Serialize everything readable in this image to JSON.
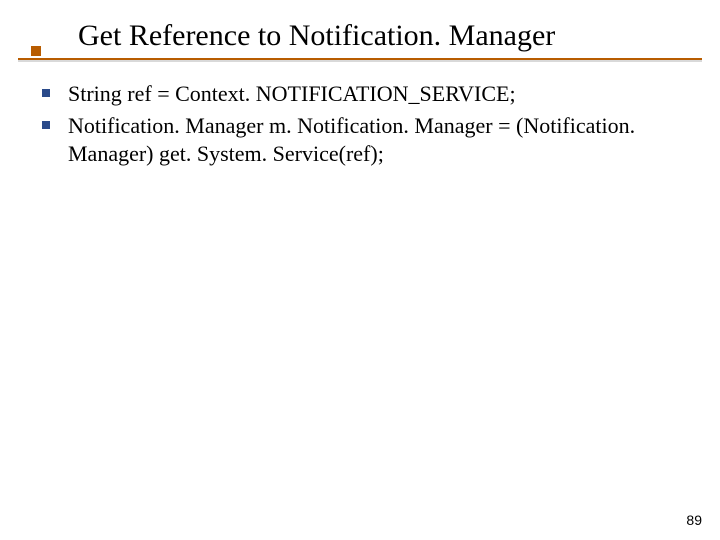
{
  "title": "Get Reference to Notification. Manager",
  "bullets": [
    "String ref = Context. NOTIFICATION_SERVICE;",
    "Notification. Manager m. Notification. Manager = (Notification. Manager) get. System. Service(ref);"
  ],
  "page_number": "89",
  "colors": {
    "rule": "#b85c00",
    "bullet": "#2a4a8a"
  }
}
